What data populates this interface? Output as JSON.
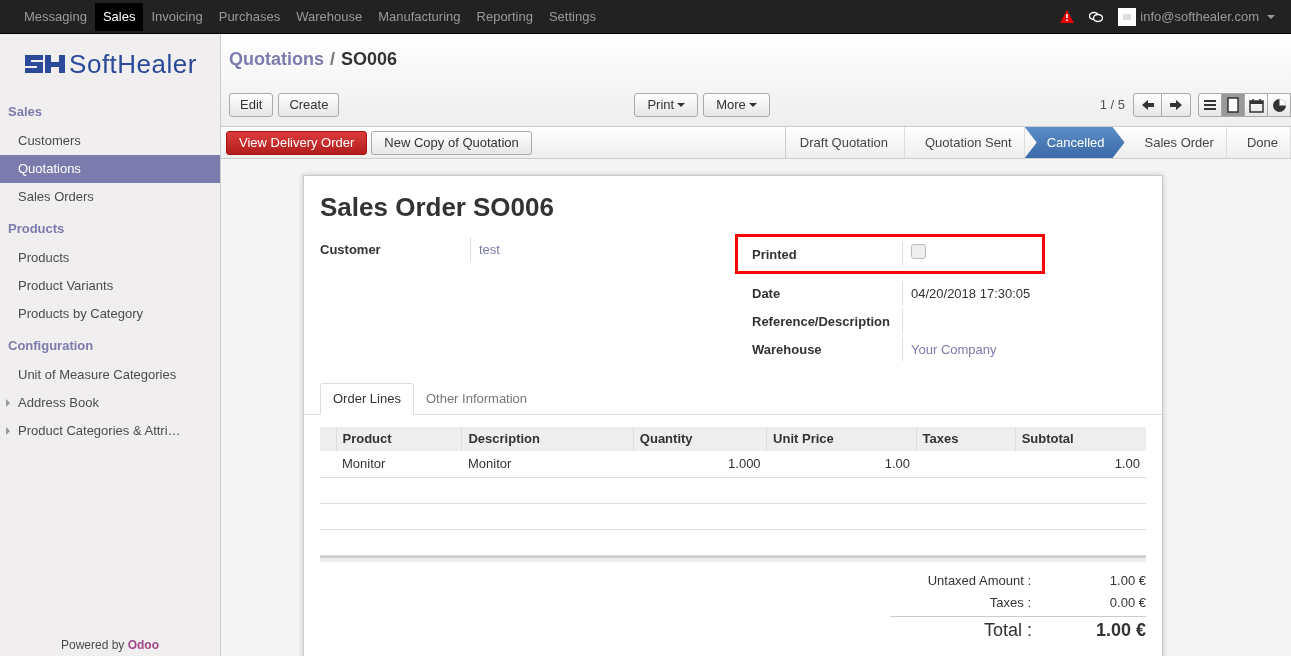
{
  "top_menu": [
    {
      "label": "Messaging",
      "selected": false
    },
    {
      "label": "Sales",
      "selected": true
    },
    {
      "label": "Invoicing",
      "selected": false
    },
    {
      "label": "Purchases",
      "selected": false
    },
    {
      "label": "Warehouse",
      "selected": false
    },
    {
      "label": "Manufacturing",
      "selected": false
    },
    {
      "label": "Reporting",
      "selected": false
    },
    {
      "label": "Settings",
      "selected": false
    }
  ],
  "user": {
    "email": "info@softhealer.com"
  },
  "logo": {
    "text": "SoftHealer"
  },
  "sidebar": {
    "sections": [
      {
        "title": "Sales",
        "items": [
          {
            "label": "Customers",
            "selected": false,
            "expandable": false
          },
          {
            "label": "Quotations",
            "selected": true,
            "expandable": false
          },
          {
            "label": "Sales Orders",
            "selected": false,
            "expandable": false
          }
        ]
      },
      {
        "title": "Products",
        "items": [
          {
            "label": "Products",
            "selected": false,
            "expandable": false
          },
          {
            "label": "Product Variants",
            "selected": false,
            "expandable": false
          },
          {
            "label": "Products by Category",
            "selected": false,
            "expandable": false
          }
        ]
      },
      {
        "title": "Configuration",
        "items": [
          {
            "label": "Unit of Measure Categories",
            "selected": false,
            "expandable": false
          },
          {
            "label": "Address Book",
            "selected": false,
            "expandable": true
          },
          {
            "label": "Product Categories & Attri…",
            "selected": false,
            "expandable": true
          }
        ]
      }
    ],
    "footer": {
      "prefix": "Powered by",
      "brand": "Odoo"
    }
  },
  "breadcrumb": {
    "parent": "Quotations",
    "separator": "/",
    "current": "SO006"
  },
  "buttons": [
    "Edit",
    "Create"
  ],
  "dropdowns": [
    "Print",
    "More"
  ],
  "pager": "1 / 5",
  "views": [
    {
      "kind": "list",
      "selected": false
    },
    {
      "kind": "form",
      "selected": true
    },
    {
      "kind": "calendar",
      "selected": false
    },
    {
      "kind": "graph",
      "selected": false
    }
  ],
  "action_buttons": [
    {
      "label": "View Delivery Order",
      "kind": "primary"
    },
    {
      "label": "New Copy of Quotation",
      "kind": "default"
    }
  ],
  "statusbar": [
    {
      "label": "Draft Quotation",
      "selected": false
    },
    {
      "label": "Quotation Sent",
      "selected": false
    },
    {
      "label": "Cancelled",
      "selected": true
    },
    {
      "label": "Sales Order",
      "selected": false
    },
    {
      "label": "Done",
      "selected": false
    }
  ],
  "form": {
    "title": "Sales Order",
    "number": "SO006",
    "left_fields": [
      {
        "label": "Customer",
        "kind": "link",
        "value": "test",
        "highlighted": false
      }
    ],
    "right_fields": [
      {
        "label": "Printed",
        "kind": "checkbox",
        "checked": false,
        "highlighted": true
      },
      {
        "label": "Date",
        "kind": "text",
        "value": "04/20/2018 17:30:05",
        "highlighted": false
      },
      {
        "label": "Reference/Description",
        "kind": "text",
        "highlighted": false
      },
      {
        "label": "Warehouse",
        "kind": "link",
        "value": "Your Company",
        "highlighted": false
      }
    ],
    "tabs": [
      {
        "label": "Order Lines",
        "selected": true
      },
      {
        "label": "Other Information",
        "selected": false
      }
    ],
    "table": {
      "columns": [
        "Product",
        "Description",
        "Quantity",
        "Unit Price",
        "Taxes",
        "Subtotal"
      ],
      "rows": [
        [
          "Monitor",
          "Monitor",
          "1.000",
          "1.00",
          "",
          "1.00"
        ]
      ]
    },
    "totals": [
      {
        "label": "Untaxed Amount :",
        "value": "1.00 €"
      },
      {
        "label": "Taxes :",
        "value": "0.00 €"
      }
    ],
    "total": {
      "label": "Total :",
      "value": "1.00 €"
    }
  }
}
